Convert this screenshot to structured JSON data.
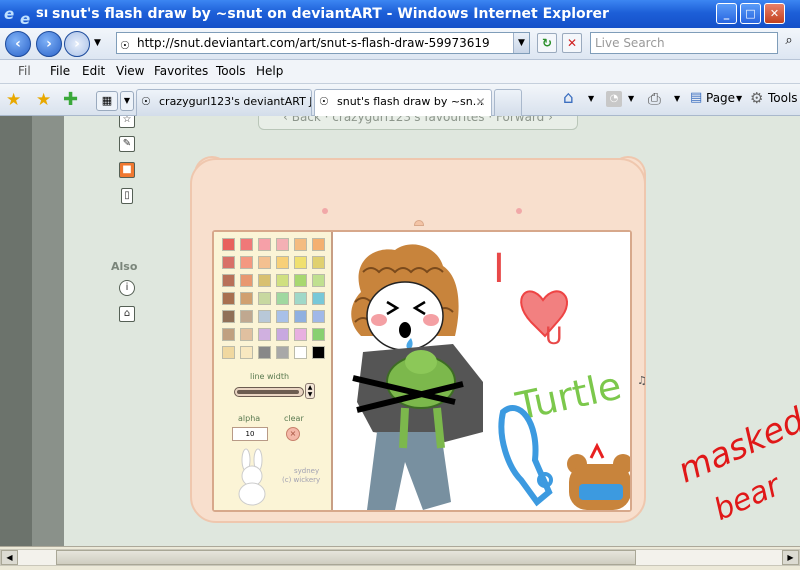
{
  "window": {
    "title": "snut's flash draw by ~snut on deviantART - Windows Internet Explorer",
    "title_prefix": "sı",
    "controls": [
      "_",
      "□",
      "✕"
    ]
  },
  "address_bar": {
    "url": "http://snut.deviantart.com/art/snut-s-flash-draw-59973619",
    "search_placeholder": "Live Search"
  },
  "menu": {
    "items": [
      "Fil",
      "File",
      "Edit",
      "View",
      "Favorites",
      "Tools",
      "Help"
    ]
  },
  "tabs": [
    {
      "label": "crazygurl123's deviantART J..."
    },
    {
      "label": "snut's flash draw by ~sn..."
    }
  ],
  "toolbar": {
    "page_label": "Page",
    "tools_label": "Tools"
  },
  "page": {
    "top_nav_text": "‹ Back · crazygurl123's favourites · Forward ›",
    "also_label": "Also"
  },
  "flash_widget": {
    "line_width_label": "line width",
    "alpha_label": "alpha",
    "clear_label": "clear",
    "alpha_value": "10",
    "credit_line1": "sydney",
    "credit_line2": "(c) wickery",
    "palette": [
      [
        "#e8605c",
        "#f07878",
        "#f6a0a8",
        "#f4b0b4",
        "#f4bc80",
        "#f4b070"
      ],
      [
        "#d87068",
        "#f49880",
        "#f4c090",
        "#f8d078",
        "#f0e070",
        "#e0d070"
      ],
      [
        "#b87058",
        "#e89870",
        "#d8c070",
        "#d0e080",
        "#a8d870",
        "#c0e090"
      ],
      [
        "#a87050",
        "#d0a070",
        "#c8d8a0",
        "#a0d8a0",
        "#a0d8c8",
        "#78c8d8"
      ],
      [
        "#907058",
        "#c0a890",
        "#b8c8d8",
        "#a8c0e8",
        "#90b0e0",
        "#a0b8e8"
      ],
      [
        "#c0a080",
        "#e0c0a0",
        "#d0b0e0",
        "#c8a8e0",
        "#e8b0e0",
        "#88d070"
      ],
      [
        "#f0d8a0",
        "#f8e8c0",
        "#888888",
        "#a8a8a8",
        "#ffffff",
        "#000000"
      ]
    ]
  },
  "canvas_text": {
    "i": "I",
    "u": "U",
    "turtle": "Turtle",
    "masked": "masked",
    "bear": "bear"
  }
}
